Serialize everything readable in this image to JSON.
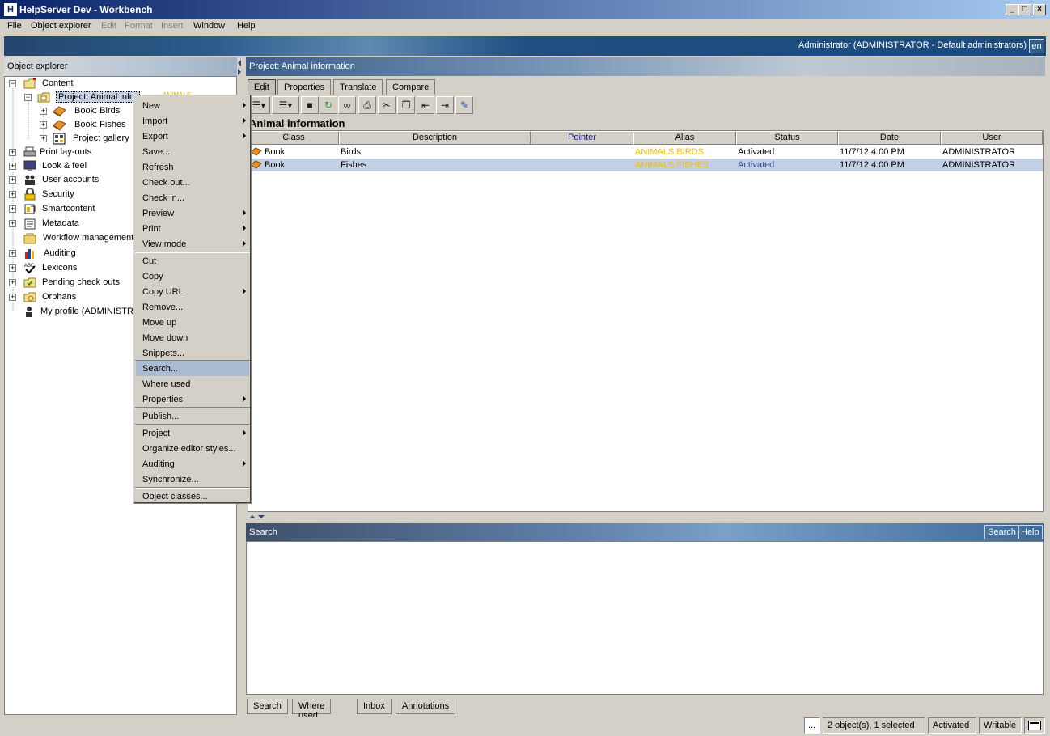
{
  "window": {
    "title": "HelpServer Dev - Workbench",
    "app_icon": "H",
    "minimize": "_",
    "maximize": "□",
    "close": "×"
  },
  "menubar": {
    "file": "File",
    "object_explorer": "Object explorer",
    "edit": "Edit",
    "format": "Format",
    "insert": "Insert",
    "window": "Window",
    "help": "Help"
  },
  "banner": {
    "user": "Administrator (ADMINISTRATOR - Default administrators)",
    "lang": "en"
  },
  "left": {
    "header": "Object explorer",
    "tree": {
      "content": "Content",
      "project": "Project: Animal infor",
      "project_alias": "ANIMALS",
      "book_birds": "Book: Birds",
      "book_fishes": "Book: Fishes",
      "project_gallery": "Project gallery",
      "print_layouts": "Print lay-outs",
      "look_feel": "Look & feel",
      "user_accounts": "User accounts",
      "security": "Security",
      "smartcontent": "Smartcontent",
      "metadata": "Metadata",
      "workflow": "Workflow management",
      "auditing": "Auditing",
      "lexicons": "Lexicons",
      "pending": "Pending check outs",
      "orphans": "Orphans",
      "my_profile": "My profile (ADMINISTRA"
    }
  },
  "right": {
    "header": "Project: Animal information",
    "tabs": {
      "edit": "Edit",
      "properties": "Properties",
      "translate": "Translate",
      "compare": "Compare"
    },
    "title": "Animal information",
    "columns": {
      "class": "Class",
      "description": "Description",
      "pointer": "Pointer",
      "alias": "Alias",
      "status": "Status",
      "date": "Date",
      "user": "User"
    },
    "rows": [
      {
        "class": "Book",
        "description": "Birds",
        "pointer": "",
        "alias": "ANIMALS.BIRDS",
        "status": "Activated",
        "date": "11/7/12 4:00 PM",
        "user": "ADMINISTRATOR"
      },
      {
        "class": "Book",
        "description": "Fishes",
        "pointer": "",
        "alias": "ANIMALS.FISHES",
        "status": "Activated",
        "date": "11/7/12 4:00 PM",
        "user": "ADMINISTRATOR"
      }
    ]
  },
  "search_panel": {
    "header": "Search",
    "search_btn": "Search",
    "help_btn": "Help"
  },
  "bottom_tabs": {
    "search": "Search",
    "where_used": "Where used",
    "inbox": "Inbox",
    "annotations": "Annotations"
  },
  "statusbar": {
    "dots": "...",
    "selection": "2 object(s), 1 selected",
    "status": "Activated",
    "mode": "Writable"
  },
  "context_menu": {
    "new": "New",
    "import": "Import",
    "export": "Export",
    "save": "Save...",
    "refresh": "Refresh",
    "check_out": "Check out...",
    "check_in": "Check in...",
    "preview": "Preview",
    "print": "Print",
    "view_mode": "View mode",
    "cut": "Cut",
    "copy": "Copy",
    "copy_url": "Copy URL",
    "remove": "Remove...",
    "move_up": "Move up",
    "move_down": "Move down",
    "snippets": "Snippets...",
    "search": "Search...",
    "where_used": "Where used",
    "properties": "Properties",
    "publish": "Publish...",
    "project": "Project",
    "organize": "Organize editor styles...",
    "auditing": "Auditing",
    "synchronize": "Synchronize...",
    "object_classes": "Object classes..."
  },
  "colors": {
    "alias": "#f0c000",
    "selection": "#c3cfe2",
    "menu_hover": "#aabcd2"
  }
}
